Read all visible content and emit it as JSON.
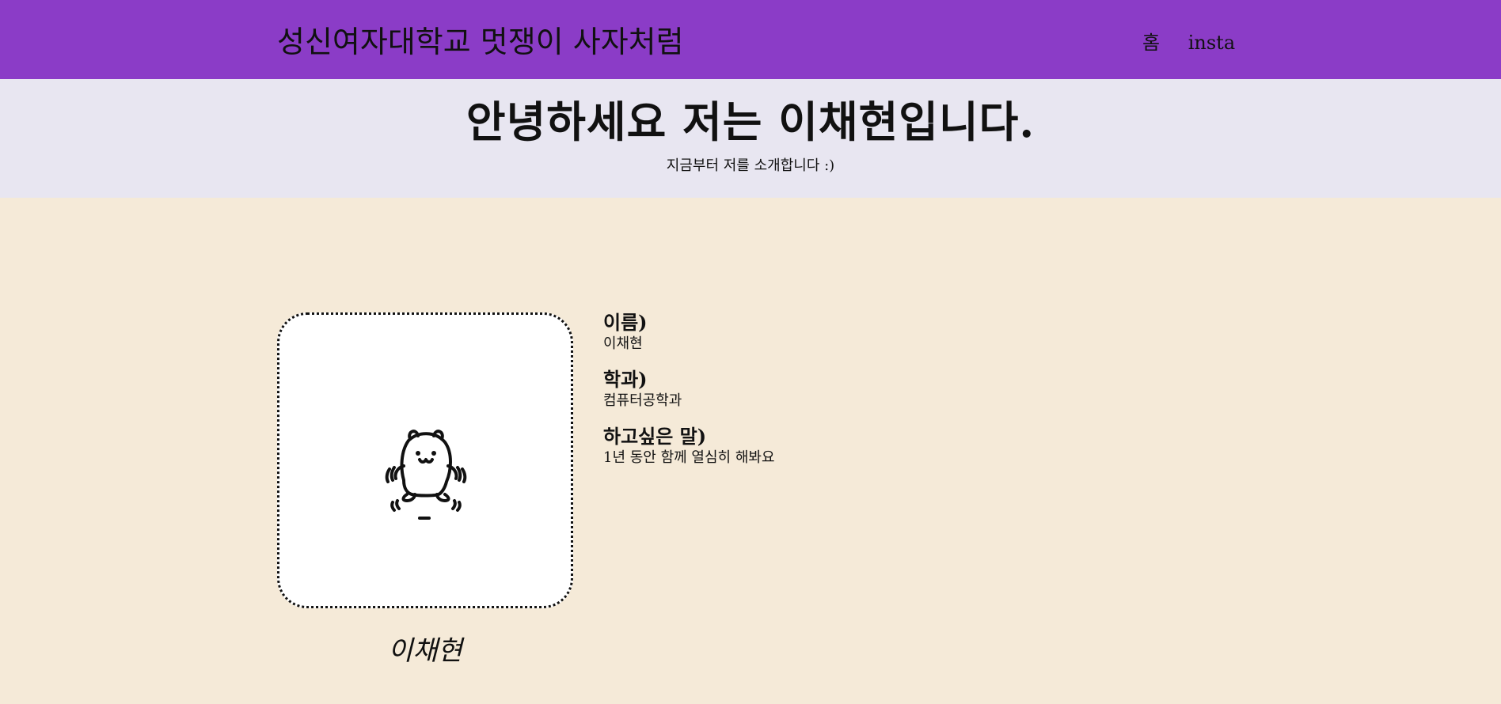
{
  "header": {
    "site_title": "성신여자대학교 멋쟁이 사자처럼",
    "nav": [
      {
        "label": "홈"
      },
      {
        "label": "insta"
      }
    ]
  },
  "hero": {
    "title": "안녕하세요 저는 이채현입니다.",
    "subtitle": "지금부터 저를 소개합니다 :)"
  },
  "profile": {
    "image_icon": "bear-icon",
    "caption": "이채현",
    "fields": [
      {
        "label": "이름)",
        "value": "이채현"
      },
      {
        "label": "학과)",
        "value": "컴퓨터공학과"
      },
      {
        "label": "하고싶은 말)",
        "value": "1년 동안 함께 열심히 해봐요"
      }
    ]
  },
  "colors": {
    "header_bg": "#8b3cc7",
    "hero_bg": "#e8e6f1",
    "body_bg": "#f5ead8"
  }
}
